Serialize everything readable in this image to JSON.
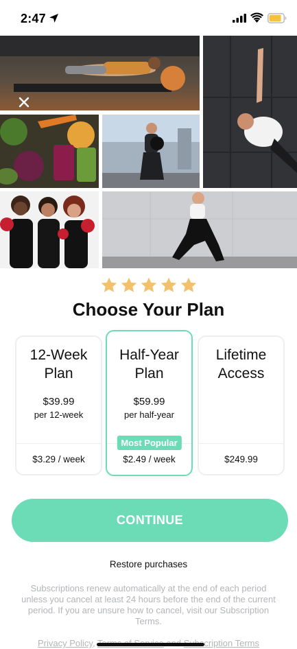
{
  "status_bar": {
    "time": "2:47",
    "icons": [
      "location-arrow-icon",
      "cellular-signal-icon",
      "wifi-icon",
      "battery-icon"
    ],
    "battery_color": "#f5c33b"
  },
  "collage": {
    "close_icon": "close-icon",
    "photos": [
      "plank-workout-photo",
      "side-plank-photo",
      "healthy-food-photo",
      "kettlebell-squat-photo",
      "group-boxing-photo",
      "walking-lunge-photo"
    ]
  },
  "rating": {
    "stars": 5,
    "star_color": "#f2c16b"
  },
  "title": "Choose Your Plan",
  "plans": [
    {
      "name_line1": "12-Week",
      "name_line2": "Plan",
      "price": "$39.99",
      "period": "per 12-week",
      "weekly": "$3.29 / week",
      "selected": false
    },
    {
      "name_line1": "Half-Year",
      "name_line2": "Plan",
      "price": "$59.99",
      "period": "per half-year",
      "weekly": "$2.49 / week",
      "badge": "Most Popular",
      "selected": true
    },
    {
      "name_line1": "Lifetime",
      "name_line2": "Access",
      "price": "",
      "period": "",
      "weekly": "$249.99",
      "selected": false
    }
  ],
  "continue_label": "CONTINUE",
  "restore_label": "Restore purchases",
  "disclaimer": "Subscriptions renew automatically at the end of each period unless you cancel at least 24 hours before the end of the current period. If you are unsure how to cancel, visit our Subscription Terms.",
  "legal": {
    "privacy": "Privacy Policy",
    "separator1": ", ",
    "terms": "Terms of Service",
    "separator2": " and ",
    "subscription": "Subscription Terms"
  },
  "colors": {
    "accent": "#6cdcb6",
    "muted_text": "#b3b5b9",
    "card_border": "#eceef0"
  }
}
